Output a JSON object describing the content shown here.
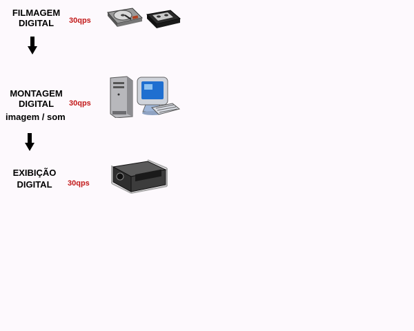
{
  "stages": [
    {
      "line1": "FILMAGEM",
      "line2": "DIGITAL",
      "rate": "30qps",
      "icons": [
        "hard-drive-icon",
        "videotape-cassette-icon"
      ]
    },
    {
      "line1": "MONTAGEM",
      "line2": "DIGITAL",
      "rate": "30qps",
      "sub": "imagem / som",
      "icons": [
        "tower-computer-icon",
        "crt-monitor-icon",
        "keyboard-icon"
      ]
    },
    {
      "line1": "EXIBIÇÃO",
      "line2": "DIGITAL",
      "rate": "30qps",
      "icons": [
        "digital-projector-icon"
      ]
    }
  ],
  "colors": {
    "background": "#fdf9fd",
    "rate": "#c21818",
    "text": "#000000",
    "arrow": "#000000"
  }
}
